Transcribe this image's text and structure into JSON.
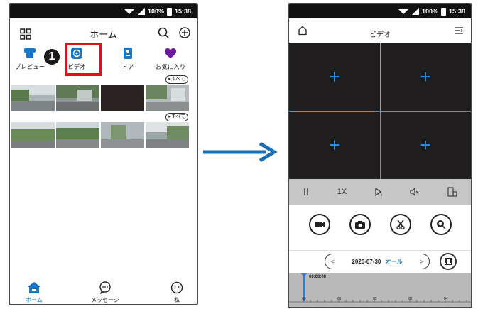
{
  "status_bar": {
    "battery": "100%",
    "time": "15:38"
  },
  "left_screen": {
    "title": "ホーム",
    "step_number": "1",
    "categories": [
      {
        "label": "プレビュー"
      },
      {
        "label": "ビデオ"
      },
      {
        "label": "ドア"
      },
      {
        "label": "お気に入り"
      }
    ],
    "see_all_label": "すべて",
    "bottom_nav": {
      "home": "ホーム",
      "message": "メッセージ",
      "me": "私"
    }
  },
  "right_screen": {
    "title": "ビデオ",
    "date": "2020-07-30",
    "filter": "オール",
    "timeline_time": "00:00:00",
    "timeline_labels": [
      "00",
      "01",
      "02",
      "03",
      "04"
    ],
    "speed_label": "1X"
  },
  "colors": {
    "accent": "#1677c9",
    "highlight": "#d9121f",
    "video_bg": "#201d1f",
    "control_bar": "#c6c6c6",
    "arrow": "#1b6fb5",
    "favorite": "#6a1b9a"
  }
}
